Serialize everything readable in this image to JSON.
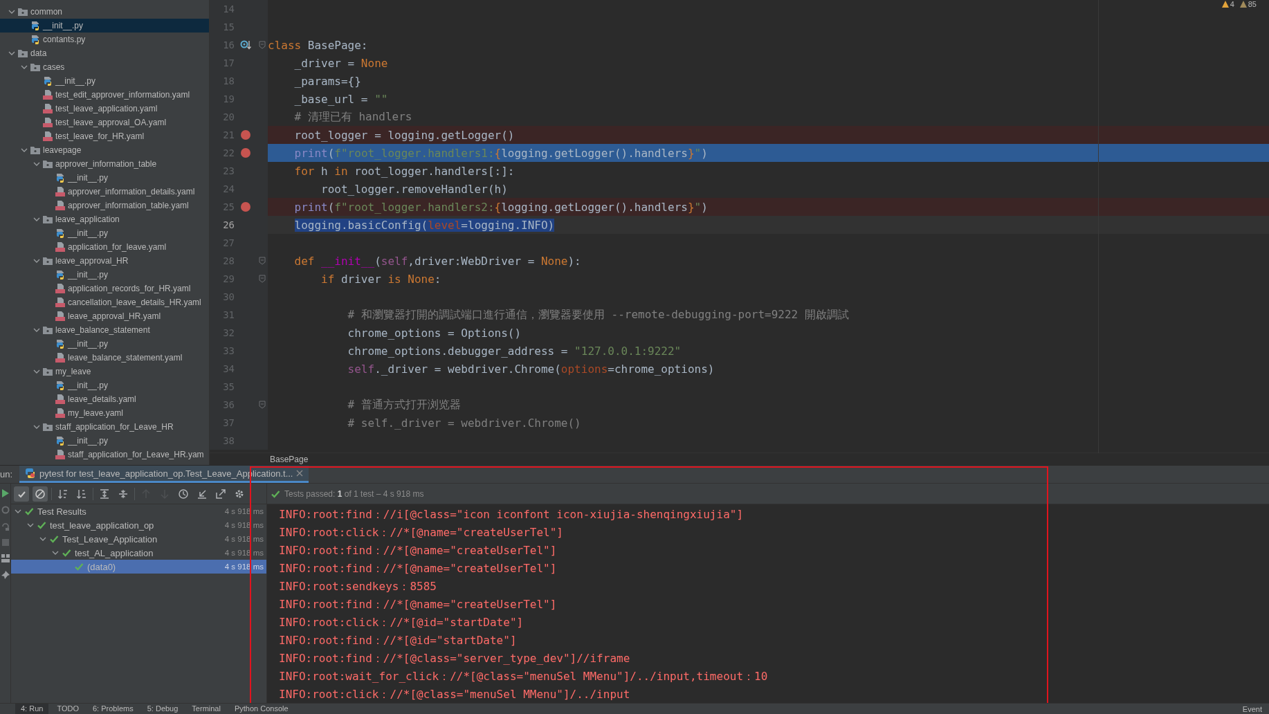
{
  "project_tree": {
    "items": [
      {
        "name": "common",
        "kind": "folder",
        "expanded": true,
        "selected": false,
        "children": [
          {
            "name": "__init__.py",
            "kind": "py",
            "selected": true
          },
          {
            "name": "contants.py",
            "kind": "py",
            "selected": false
          }
        ]
      },
      {
        "name": "data",
        "kind": "folder",
        "expanded": true,
        "selected": false,
        "children": [
          {
            "name": "cases",
            "kind": "folder",
            "expanded": true,
            "selected": false,
            "children": [
              {
                "name": "__init__.py",
                "kind": "py",
                "selected": false
              },
              {
                "name": "test_edit_approver_information.yaml",
                "kind": "yaml",
                "selected": false
              },
              {
                "name": "test_leave_application.yaml",
                "kind": "yaml",
                "selected": false
              },
              {
                "name": "test_leave_approval_OA.yaml",
                "kind": "yaml",
                "selected": false
              },
              {
                "name": "test_leave_for_HR.yaml",
                "kind": "yaml",
                "selected": false
              }
            ]
          },
          {
            "name": "leavepage",
            "kind": "folder",
            "expanded": true,
            "selected": false,
            "children": [
              {
                "name": "approver_information_table",
                "kind": "folder",
                "expanded": true,
                "selected": false,
                "children": [
                  {
                    "name": "__init__.py",
                    "kind": "py",
                    "selected": false
                  },
                  {
                    "name": "approver_information_details.yaml",
                    "kind": "yaml",
                    "selected": false
                  },
                  {
                    "name": "approver_information_table.yaml",
                    "kind": "yaml",
                    "selected": false
                  }
                ]
              },
              {
                "name": "leave_application",
                "kind": "folder",
                "expanded": true,
                "selected": false,
                "children": [
                  {
                    "name": "__init__.py",
                    "kind": "py",
                    "selected": false
                  },
                  {
                    "name": "application_for_leave.yaml",
                    "kind": "yaml",
                    "selected": false
                  }
                ]
              },
              {
                "name": "leave_approval_HR",
                "kind": "folder",
                "expanded": true,
                "selected": false,
                "children": [
                  {
                    "name": "__init__.py",
                    "kind": "py",
                    "selected": false
                  },
                  {
                    "name": "application_records_for_HR.yaml",
                    "kind": "yaml",
                    "selected": false
                  },
                  {
                    "name": "cancellation_leave_details_HR.yaml",
                    "kind": "yaml",
                    "selected": false
                  },
                  {
                    "name": "leave_approval_HR.yaml",
                    "kind": "yaml",
                    "selected": false
                  }
                ]
              },
              {
                "name": "leave_balance_statement",
                "kind": "folder",
                "expanded": true,
                "selected": false,
                "children": [
                  {
                    "name": "__init__.py",
                    "kind": "py",
                    "selected": false
                  },
                  {
                    "name": "leave_balance_statement.yaml",
                    "kind": "yaml",
                    "selected": false
                  }
                ]
              },
              {
                "name": "my_leave",
                "kind": "folder",
                "expanded": true,
                "selected": false,
                "children": [
                  {
                    "name": "__init__.py",
                    "kind": "py",
                    "selected": false
                  },
                  {
                    "name": "leave_details.yaml",
                    "kind": "yaml",
                    "selected": false
                  },
                  {
                    "name": "my_leave.yaml",
                    "kind": "yaml",
                    "selected": false
                  }
                ]
              },
              {
                "name": "staff_application_for_Leave_HR",
                "kind": "folder",
                "expanded": true,
                "selected": false,
                "children": [
                  {
                    "name": "__init__.py",
                    "kind": "py",
                    "selected": false
                  },
                  {
                    "name": "staff_application_for_Leave_HR.yam",
                    "kind": "yaml",
                    "selected": false
                  }
                ]
              }
            ]
          }
        ]
      }
    ]
  },
  "editor": {
    "inspections": [
      {
        "count": "4"
      },
      {
        "count": "85"
      }
    ],
    "lines": [
      {
        "number": "14"
      },
      {
        "number": "15"
      },
      {
        "number": "16",
        "gutter": {
          "kind": "override"
        },
        "fold": {
          "kind": "start"
        },
        "tokens": [
          {
            "kind": "kw",
            "text": "class"
          },
          {
            "kind": "text",
            "text": " BasePage:"
          }
        ]
      },
      {
        "number": "17",
        "tokens": [
          {
            "kind": "text",
            "text": "    _driver = "
          },
          {
            "kind": "kw",
            "text": "None"
          }
        ]
      },
      {
        "number": "18",
        "tokens": [
          {
            "kind": "text",
            "text": "    _params={}"
          }
        ]
      },
      {
        "number": "19",
        "tokens": [
          {
            "kind": "text",
            "text": "    _base_url = "
          },
          {
            "kind": "str",
            "text": "\"\""
          }
        ]
      },
      {
        "number": "20",
        "tokens": [
          {
            "kind": "comment",
            "text": "    # 清理已有 handlers"
          }
        ]
      },
      {
        "number": "21",
        "gutter": {
          "kind": "breakpoint"
        },
        "highlight": {
          "kind": "breakpoint"
        },
        "tokens": [
          {
            "kind": "text",
            "text": "    root_logger = logging.getLogger()"
          }
        ]
      },
      {
        "number": "22",
        "gutter": {
          "kind": "breakpoint"
        },
        "highlight": {
          "kind": "execution"
        },
        "tokens": [
          {
            "kind": "builtin",
            "text": "    print"
          },
          {
            "kind": "text",
            "text": "("
          },
          {
            "kind": "str",
            "text": "f\"root_logger.handlers1:"
          },
          {
            "kind": "kw",
            "text": "{"
          },
          {
            "kind": "text",
            "text": "logging.getLogger().handlers"
          },
          {
            "kind": "kw",
            "text": "}"
          },
          {
            "kind": "str",
            "text": "\""
          },
          {
            "kind": "text",
            "text": ")"
          }
        ]
      },
      {
        "number": "23",
        "tokens": [
          {
            "kind": "kw",
            "text": "    for"
          },
          {
            "kind": "text",
            "text": " h "
          },
          {
            "kind": "kw",
            "text": "in"
          },
          {
            "kind": "text",
            "text": " root_logger.handlers[:]:"
          }
        ]
      },
      {
        "number": "24",
        "tokens": [
          {
            "kind": "text",
            "text": "        root_logger.removeHandler(h)"
          }
        ]
      },
      {
        "number": "25",
        "gutter": {
          "kind": "breakpoint"
        },
        "highlight": {
          "kind": "breakpoint"
        },
        "tokens": [
          {
            "kind": "builtin",
            "text": "    print"
          },
          {
            "kind": "text",
            "text": "("
          },
          {
            "kind": "str",
            "text": "f\"root_logger.handlers2:"
          },
          {
            "kind": "kw",
            "text": "{"
          },
          {
            "kind": "text",
            "text": "logging.getLogger().handlers"
          },
          {
            "kind": "kw",
            "text": "}"
          },
          {
            "kind": "str",
            "text": "\""
          },
          {
            "kind": "text",
            "text": ")"
          }
        ]
      },
      {
        "number": "26",
        "highlight": {
          "kind": "selection"
        },
        "tokens": [
          {
            "kind": "text",
            "text": "    logging.basicConfig("
          },
          {
            "kind": "param",
            "text": "level"
          },
          {
            "kind": "text",
            "text": "=logging.INFO)"
          }
        ]
      },
      {
        "number": "27"
      },
      {
        "number": "28",
        "fold": {
          "kind": "start"
        },
        "tokens": [
          {
            "kind": "kw",
            "text": "    def "
          },
          {
            "kind": "dunder",
            "text": "__init__"
          },
          {
            "kind": "text",
            "text": "("
          },
          {
            "kind": "self",
            "text": "self"
          },
          {
            "kind": "text",
            "text": ",driver:WebDriver = "
          },
          {
            "kind": "kw",
            "text": "None"
          },
          {
            "kind": "text",
            "text": "):"
          }
        ]
      },
      {
        "number": "29",
        "fold": {
          "kind": "start"
        },
        "tokens": [
          {
            "kind": "kw",
            "text": "        if"
          },
          {
            "kind": "text",
            "text": " driver "
          },
          {
            "kind": "kw",
            "text": "is None"
          },
          {
            "kind": "text",
            "text": ":"
          }
        ]
      },
      {
        "number": "30"
      },
      {
        "number": "31",
        "tokens": [
          {
            "kind": "comment",
            "text": "            # 和瀏覽器打開的調試端口進行通信，瀏覽器要使用 --remote-debugging-port=9222 開啟調試"
          }
        ]
      },
      {
        "number": "32",
        "tokens": [
          {
            "kind": "text",
            "text": "            chrome_options = Options()"
          }
        ]
      },
      {
        "number": "33",
        "tokens": [
          {
            "kind": "text",
            "text": "            chrome_options.debugger_address = "
          },
          {
            "kind": "str",
            "text": "\"127.0.0.1:9222\""
          }
        ]
      },
      {
        "number": "34",
        "tokens": [
          {
            "kind": "self",
            "text": "            self"
          },
          {
            "kind": "text",
            "text": "._driver = webdriver.Chrome("
          },
          {
            "kind": "param",
            "text": "options"
          },
          {
            "kind": "text",
            "text": "=chrome_options)"
          }
        ]
      },
      {
        "number": "35"
      },
      {
        "number": "36",
        "fold": {
          "kind": "start"
        },
        "tokens": [
          {
            "kind": "comment",
            "text": "            # 普通方式打开浏览器"
          }
        ]
      },
      {
        "number": "37",
        "tokens": [
          {
            "kind": "comment",
            "text": "            # self._driver = webdriver.Chrome()"
          }
        ]
      },
      {
        "number": "38"
      }
    ],
    "breadcrumb": "BasePage"
  },
  "run_panel": {
    "label": "un:",
    "tab": {
      "title": "pytest for test_leave_application_op.Test_Leave_Application.t...",
      "selected": true
    },
    "toolbar": [
      {
        "toggled": true,
        "disabled": false
      },
      {
        "toggled": true,
        "disabled": false
      },
      {
        "toggled": false,
        "disabled": false
      },
      {
        "toggled": false,
        "disabled": false
      },
      {
        "toggled": false,
        "disabled": false
      },
      {
        "toggled": false,
        "disabled": false
      },
      {
        "toggled": false,
        "disabled": true
      },
      {
        "toggled": false,
        "disabled": true
      },
      {
        "toggled": false,
        "disabled": false
      },
      {
        "toggled": false,
        "disabled": false
      },
      {
        "toggled": false,
        "disabled": false
      },
      {
        "toggled": false,
        "disabled": false
      }
    ],
    "status": "Tests passed: **1** of 1 test – 4 s 918 ms",
    "results": [
      {
        "label": "Test Results",
        "time": "4 s 918 ms",
        "passed": true,
        "expanded": true,
        "selected": false,
        "children": [
          {
            "label": "test_leave_application_op",
            "time": "4 s 918 ms",
            "passed": true,
            "expanded": true,
            "selected": false,
            "children": [
              {
                "label": "Test_Leave_Application",
                "time": "4 s 918 ms",
                "passed": true,
                "expanded": true,
                "selected": false,
                "children": [
                  {
                    "label": "test_AL_application",
                    "time": "4 s 918 ms",
                    "passed": true,
                    "expanded": true,
                    "selected": false,
                    "children": [
                      {
                        "label": "(data0)",
                        "time": "4 s 918 ms",
                        "passed": true,
                        "selected": true
                      }
                    ]
                  }
                ]
              }
            ]
          }
        ]
      }
    ],
    "console": [
      "INFO:root:find：//i[@class=\"icon iconfont icon-xiujia-shenqingxiujia\"]",
      "INFO:root:click：//*[@name=\"createUserTel\"]",
      "INFO:root:find：//*[@name=\"createUserTel\"]",
      "INFO:root:find：//*[@name=\"createUserTel\"]",
      "INFO:root:sendkeys：8585",
      "INFO:root:find：//*[@name=\"createUserTel\"]",
      "INFO:root:click：//*[@id=\"startDate\"]",
      "INFO:root:find：//*[@id=\"startDate\"]",
      "INFO:root:find：//*[@class=\"server_type_dev\"]//iframe",
      "INFO:root:wait_for_click：//*[@class=\"menuSel MMenu\"]/../input,timeout：10",
      "INFO:root:click：//*[@class=\"menuSel MMenu\"]/../input"
    ]
  },
  "bottom_bar": {
    "tabs": [
      {
        "label": "4: Run",
        "selected": true
      },
      {
        "label": "TODO",
        "selected": false
      },
      {
        "label": "6: Problems",
        "selected": false
      },
      {
        "label": "5: Debug",
        "selected": false
      },
      {
        "label": "Terminal",
        "selected": false
      },
      {
        "label": "Python Console",
        "selected": false
      }
    ],
    "right": "Event"
  }
}
